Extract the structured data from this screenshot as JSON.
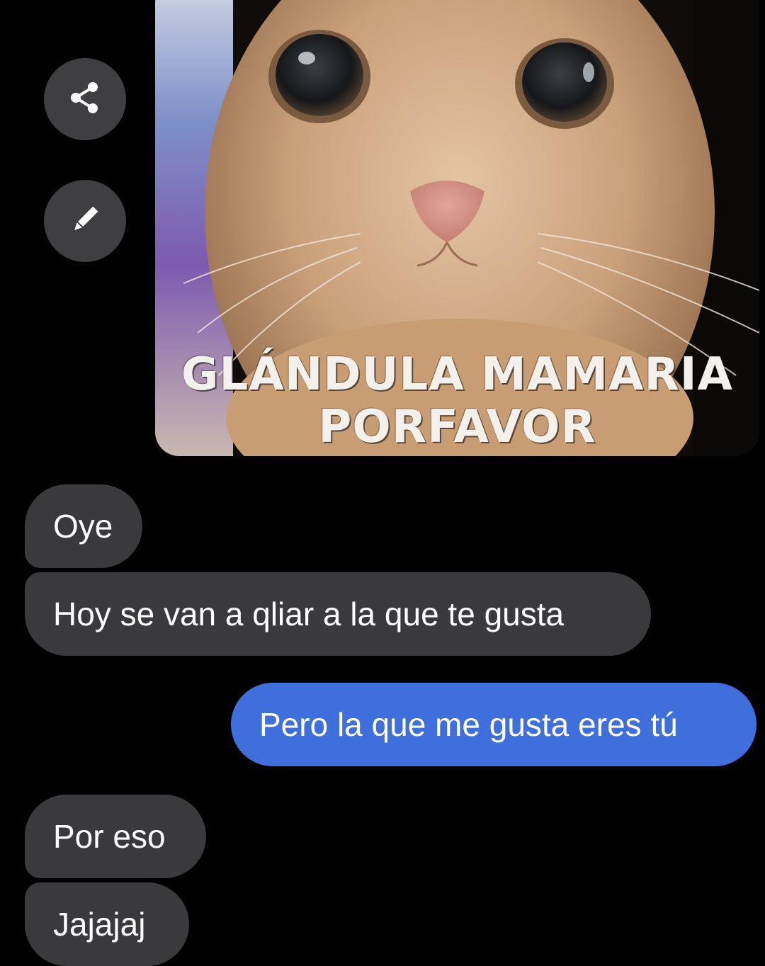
{
  "chat": {
    "image_message": {
      "caption_line1": "GLÁNDULA MAMARIA",
      "caption_line2": "PORFAVOR"
    },
    "actions": {
      "share_icon": "share-icon",
      "edit_icon": "pencil-icon"
    },
    "messages": [
      {
        "side": "incoming",
        "text": "Oye"
      },
      {
        "side": "incoming",
        "text": "Hoy se van a qliar a la que te gusta"
      },
      {
        "side": "outgoing",
        "text": "Pero la que me gusta eres tú"
      },
      {
        "side": "incoming",
        "text": "Por eso"
      },
      {
        "side": "incoming",
        "text": "Jajajaj"
      }
    ]
  },
  "colors": {
    "background": "#000000",
    "incoming_bubble": "#3a3a3c",
    "outgoing_bubble": "#3f6fdc",
    "action_button": "#3f3f41"
  }
}
